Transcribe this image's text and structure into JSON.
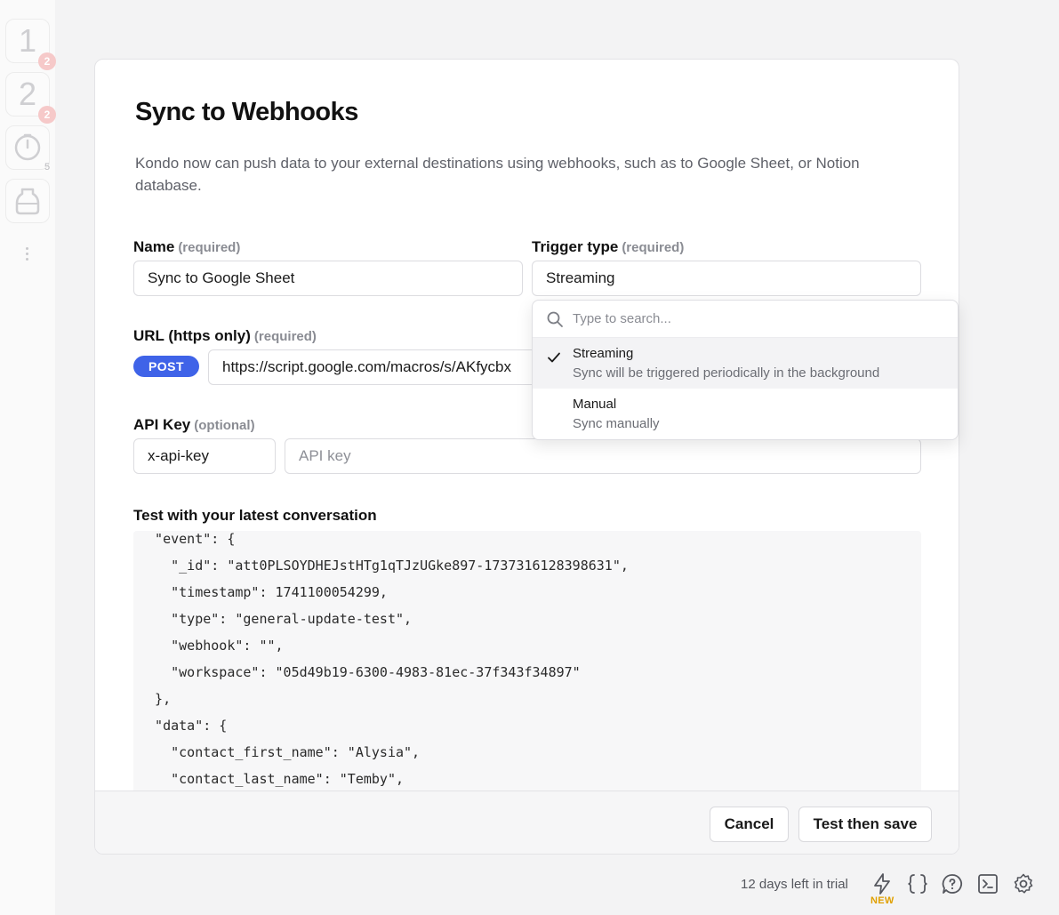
{
  "sidebar": {
    "items": [
      {
        "glyph": "1",
        "badge": "2"
      },
      {
        "glyph": "2",
        "badge": "2"
      },
      {
        "glyph": "",
        "count": "5"
      },
      {
        "glyph": ""
      }
    ]
  },
  "modal": {
    "title": "Sync to Webhooks",
    "description": "Kondo now can push data to your external destinations using webhooks, such as to Google Sheet, or Notion database.",
    "name_field": {
      "label": "Name",
      "req": "(required)",
      "value": "Sync to Google Sheet"
    },
    "trigger_field": {
      "label": "Trigger type",
      "req": "(required)",
      "value": "Streaming"
    },
    "url_field": {
      "label": "URL (https only)",
      "req": "(required)",
      "method": "POST",
      "value": "https://script.google.com/macros/s/AKfycbx"
    },
    "api_key_field": {
      "label": "API Key",
      "req": "(optional)",
      "header_value": "x-api-key",
      "key_placeholder": "API key"
    },
    "test_label": "Test with your latest conversation",
    "code_lines": [
      "  \"event\": {",
      "    \"_id\": \"att0PLSOYDHEJstHTg1qTJzUGke897-1737316128398631\",",
      "    \"timestamp\": 1741100054299,",
      "    \"type\": \"general-update-test\",",
      "    \"webhook\": \"\",",
      "    \"workspace\": \"05d49b19-6300-4983-81ec-37f343f34897\"",
      "  },",
      "  \"data\": {",
      "    \"contact_first_name\": \"Alysia\",",
      "    \"contact_last_name\": \"Temby\","
    ],
    "cancel_label": "Cancel",
    "save_label": "Test then save"
  },
  "dropdown": {
    "search_placeholder": "Type to search...",
    "options": [
      {
        "title": "Streaming",
        "subtitle": "Sync will be triggered periodically in the background",
        "selected": true
      },
      {
        "title": "Manual",
        "subtitle": "Sync manually",
        "selected": false
      }
    ]
  },
  "statusbar": {
    "trial_text": "12 days left in trial",
    "new_tag": "NEW",
    "icons": [
      "lightning-icon",
      "braces-icon",
      "help-chat-icon",
      "terminal-icon",
      "gear-icon"
    ]
  },
  "colors": {
    "accent": "#3f63e8",
    "new_tag": "#e0a000",
    "badge": "#f6c9c9"
  }
}
